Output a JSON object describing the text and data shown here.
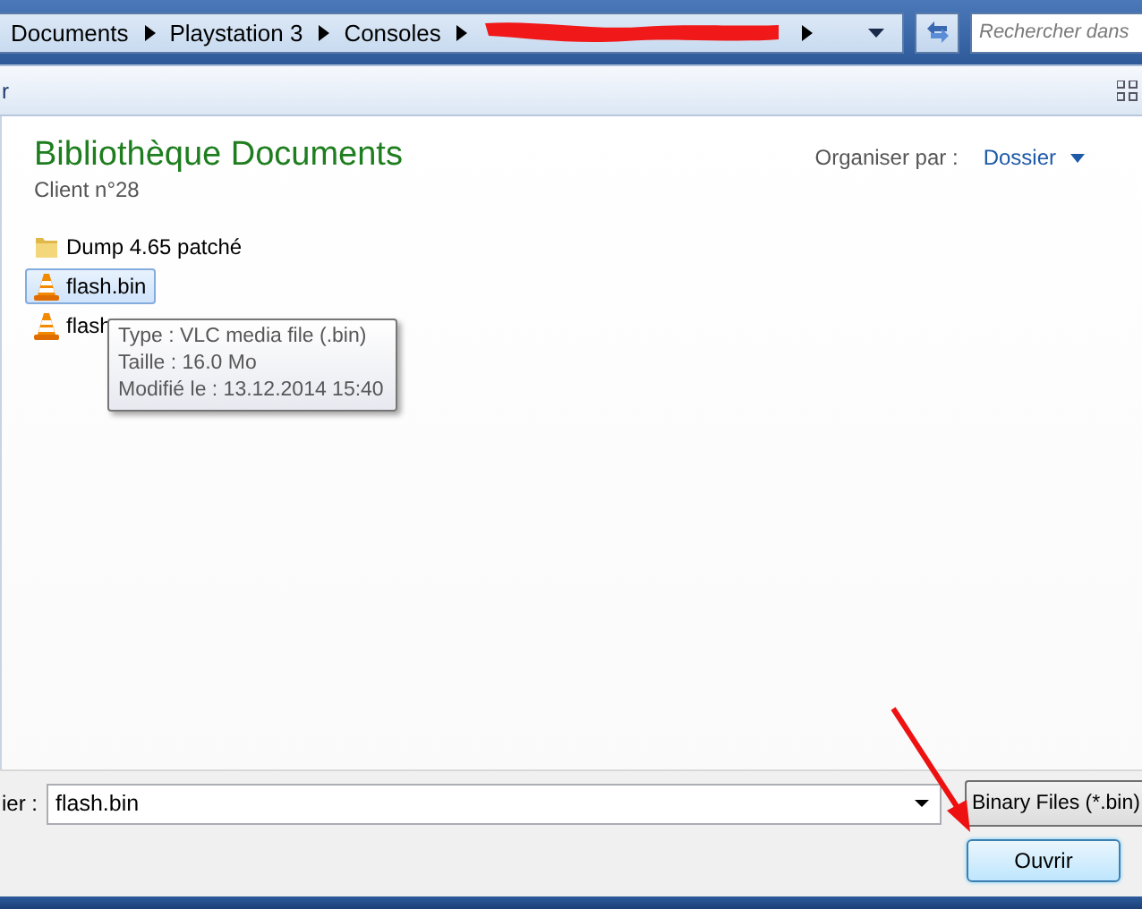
{
  "address_bar": {
    "crumbs": [
      {
        "kind": "text",
        "label": "Documents"
      },
      {
        "kind": "text",
        "label": "Playstation 3"
      },
      {
        "kind": "text",
        "label": "Consoles"
      },
      {
        "kind": "redacted"
      }
    ],
    "search": {
      "placeholder": "Rechercher dans"
    }
  },
  "toolbar": {
    "left_text": "r"
  },
  "library": {
    "title": "Bibliothèque Documents",
    "subtitle": "Client n°28",
    "arrange_label": "Organiser par :",
    "arrange_value": "Dossier"
  },
  "files": [
    {
      "name": "Dump 4.65 patché",
      "kind": "folder",
      "selected": false
    },
    {
      "name": "flash.bin",
      "kind": "vlc",
      "selected": true
    },
    {
      "name": "flash",
      "kind": "vlc",
      "selected": false
    }
  ],
  "tooltip": [
    "Type : VLC media file (.bin)",
    "Taille : 16.0 Mo",
    "Modifié le : 13.12.2014 15:40"
  ],
  "bottom": {
    "filename_label": "ier :",
    "filename_value": "flash.bin",
    "file_type": "Binary Files (*.bin)",
    "open_button": "Ouvrir"
  }
}
